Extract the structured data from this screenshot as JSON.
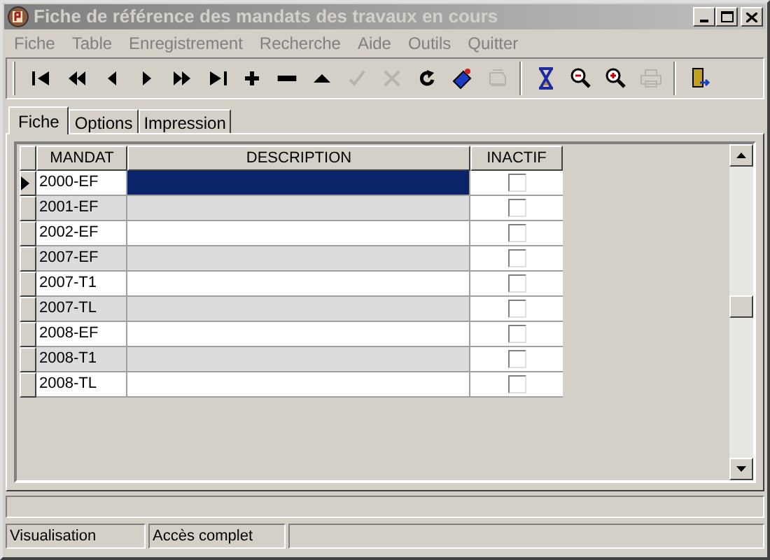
{
  "window": {
    "title": "Fiche de référence des mandats des travaux en cours",
    "active": false
  },
  "menu": [
    {
      "label": "Fiche",
      "disabled": true
    },
    {
      "label": "Table",
      "disabled": true
    },
    {
      "label": "Enregistrement",
      "disabled": true
    },
    {
      "label": "Recherche",
      "disabled": true
    },
    {
      "label": "Aide",
      "disabled": true
    },
    {
      "label": "Outils",
      "disabled": true
    },
    {
      "label": "Quitter",
      "disabled": true
    }
  ],
  "toolbar": [
    {
      "kind": "first",
      "disabled": false
    },
    {
      "kind": "prev-page",
      "disabled": false
    },
    {
      "kind": "prev",
      "disabled": false
    },
    {
      "kind": "next",
      "disabled": false
    },
    {
      "kind": "next-page",
      "disabled": false
    },
    {
      "kind": "last",
      "disabled": false
    },
    {
      "kind": "add",
      "disabled": false
    },
    {
      "kind": "remove",
      "disabled": false
    },
    {
      "kind": "up",
      "disabled": false
    },
    {
      "kind": "confirm",
      "disabled": true
    },
    {
      "kind": "cancel",
      "disabled": true
    },
    {
      "kind": "refresh",
      "disabled": false
    },
    {
      "kind": "tag",
      "disabled": false
    },
    {
      "kind": "goto",
      "disabled": true
    },
    {
      "kind": "separator"
    },
    {
      "kind": "hourglass",
      "disabled": false
    },
    {
      "kind": "zoom-out",
      "disabled": false
    },
    {
      "kind": "zoom-in",
      "disabled": false
    },
    {
      "kind": "print",
      "disabled": true
    },
    {
      "kind": "separator"
    },
    {
      "kind": "exit",
      "disabled": false
    }
  ],
  "tabs": [
    {
      "label": "Fiche",
      "selected": true
    },
    {
      "label": "Options",
      "selected": false
    },
    {
      "label": "Impression",
      "selected": false
    }
  ],
  "table": {
    "columns": [
      "MANDAT",
      "DESCRIPTION",
      "INACTIF"
    ],
    "rows": [
      {
        "mandat": "2000-EF",
        "inactive": false,
        "selected": true
      },
      {
        "mandat": "2001-EF",
        "inactive": false,
        "selected": false
      },
      {
        "mandat": "2002-EF",
        "inactive": false,
        "selected": false
      },
      {
        "mandat": "2007-EF",
        "inactive": false,
        "selected": false
      },
      {
        "mandat": "2007-T1",
        "inactive": false,
        "selected": false
      },
      {
        "mandat": "2007-TL",
        "inactive": false,
        "selected": false
      },
      {
        "mandat": "2008-EF",
        "inactive": false,
        "selected": false
      },
      {
        "mandat": "2008-T1",
        "inactive": false,
        "selected": false
      },
      {
        "mandat": "2008-TL",
        "inactive": false,
        "selected": false
      }
    ]
  },
  "status_bar": [
    "Visualisation",
    "Accès complet"
  ]
}
